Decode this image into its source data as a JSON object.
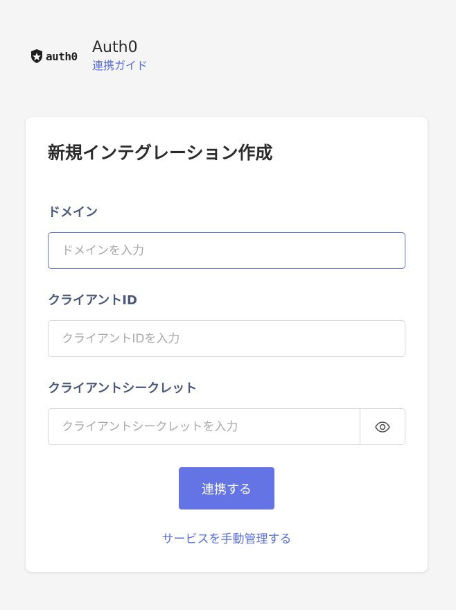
{
  "header": {
    "logo_text": "auth0",
    "app_name": "Auth0",
    "guide_link": "連携ガイド"
  },
  "form": {
    "title": "新規インテグレーション作成",
    "domain": {
      "label": "ドメイン",
      "placeholder": "ドメインを入力",
      "value": ""
    },
    "client_id": {
      "label": "クライアントID",
      "placeholder": "クライアントIDを入力",
      "value": ""
    },
    "client_secret": {
      "label": "クライアントシークレット",
      "placeholder": "クライアントシークレットを入力",
      "value": "",
      "toggle_icon": "eye-icon"
    },
    "submit_label": "連携する",
    "manual_link": "サービスを手動管理する"
  },
  "colors": {
    "accent": "#6474e4",
    "link": "#5a6fdc",
    "label": "#4a5878",
    "background": "#f5f5f5"
  }
}
